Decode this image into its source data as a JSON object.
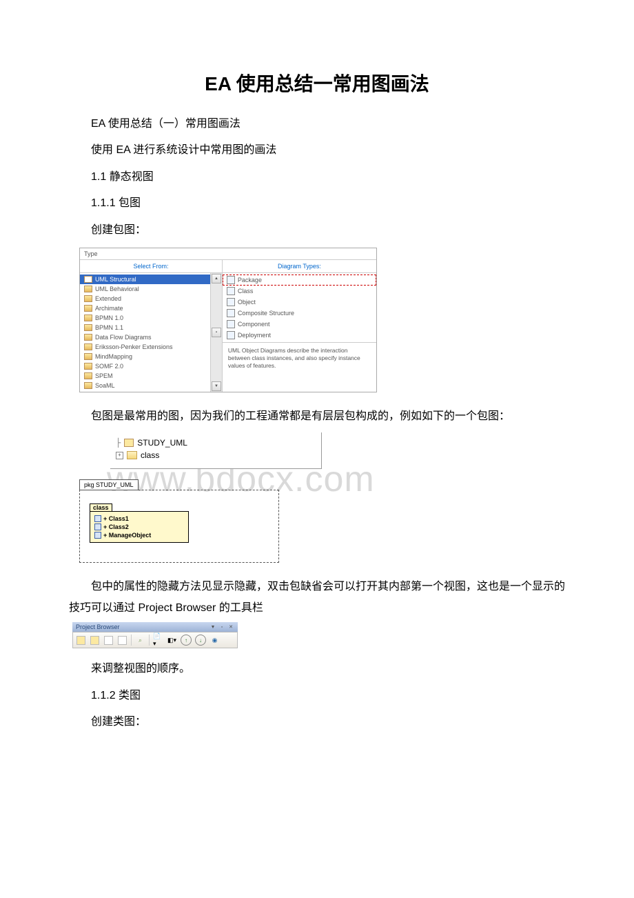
{
  "title": "EA 使用总结一常用图画法",
  "p1": "EA 使用总结（一）常用图画法",
  "p2": "使用 EA 进行系统设计中常用图的画法",
  "p3": "1.1 静态视图",
  "p4": "1.1.1 包图",
  "p5": "创建包图：",
  "dialog": {
    "type_label": "Type",
    "left_header": "Select From:",
    "right_header": "Diagram Types:",
    "left_items": [
      "UML Structural",
      "UML Behavioral",
      "Extended",
      "Archimate",
      "BPMN 1.0",
      "BPMN 1.1",
      "Data Flow Diagrams",
      "Eriksson-Penker Extensions",
      "MindMapping",
      "SOMF 2.0",
      "SPEM",
      "SoaML"
    ],
    "right_items": [
      "Package",
      "Class",
      "Object",
      "Composite Structure",
      "Component",
      "Deployment"
    ],
    "desc": "UML Object Diagrams describe the interaction between class instances, and also specify instance values of features."
  },
  "p6": "包图是最常用的图，因为我们的工程通常都是有层层包构成的，例如如下的一个包图：",
  "watermark": "www.bdocx.com",
  "tree": {
    "item1": "STUDY_UML",
    "item2": "class"
  },
  "pkg": {
    "outer": "pkg STUDY_UML",
    "inner": "class",
    "rows": [
      "+ Class1",
      "+ Class2",
      "+ ManageObject"
    ]
  },
  "p7": "包中的属性的隐藏方法见显示隐藏，双击包缺省会可以打开其内部第一个视图，这也是一个显示的技巧可以通过 Project Browser 的工具栏",
  "toolbar": {
    "title": "Project Browser"
  },
  "p8": "来调整视图的顺序。",
  "p9": "1.1.2 类图",
  "p10": "创建类图："
}
